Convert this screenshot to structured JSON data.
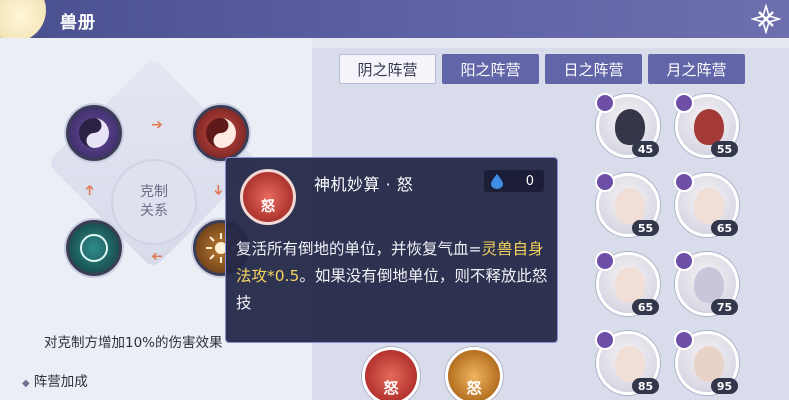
{
  "window": {
    "title": "兽册"
  },
  "tabs": [
    {
      "label": "阴之阵营",
      "active": true
    },
    {
      "label": "阳之阵营",
      "active": false
    },
    {
      "label": "日之阵营",
      "active": false
    },
    {
      "label": "月之阵营",
      "active": false
    }
  ],
  "relations": {
    "center_line1": "克制",
    "center_line2": "关系",
    "nodes": [
      "yin-icon",
      "yang-icon",
      "moon-icon",
      "sun-icon"
    ],
    "description": "对克制方增加10%的伤害效果"
  },
  "section": {
    "title": "阵营加成"
  },
  "beasts": [
    {
      "level": "45"
    },
    {
      "level": "55"
    },
    {
      "level": "55"
    },
    {
      "level": "65"
    },
    {
      "level": "65"
    },
    {
      "level": "75"
    },
    {
      "level": "85"
    },
    {
      "level": "95"
    }
  ],
  "skills": [
    {
      "label": "怒",
      "color": "#c0392b"
    },
    {
      "label": "怒",
      "color": "#d4862f"
    }
  ],
  "tooltip": {
    "skill_name": "神机妙算 · 怒",
    "icon_label": "怒",
    "cost": "0",
    "desc_part1": "复活所有倒地的单位，并恢复气血=",
    "desc_highlight": "灵兽自身法攻*0.5",
    "desc_part2": "。如果没有倒地单位，则不释放此怒技"
  },
  "colors": {
    "accent": "#6266a8",
    "highlight": "#f5d35c",
    "titlebar": "#4a4f8e"
  }
}
